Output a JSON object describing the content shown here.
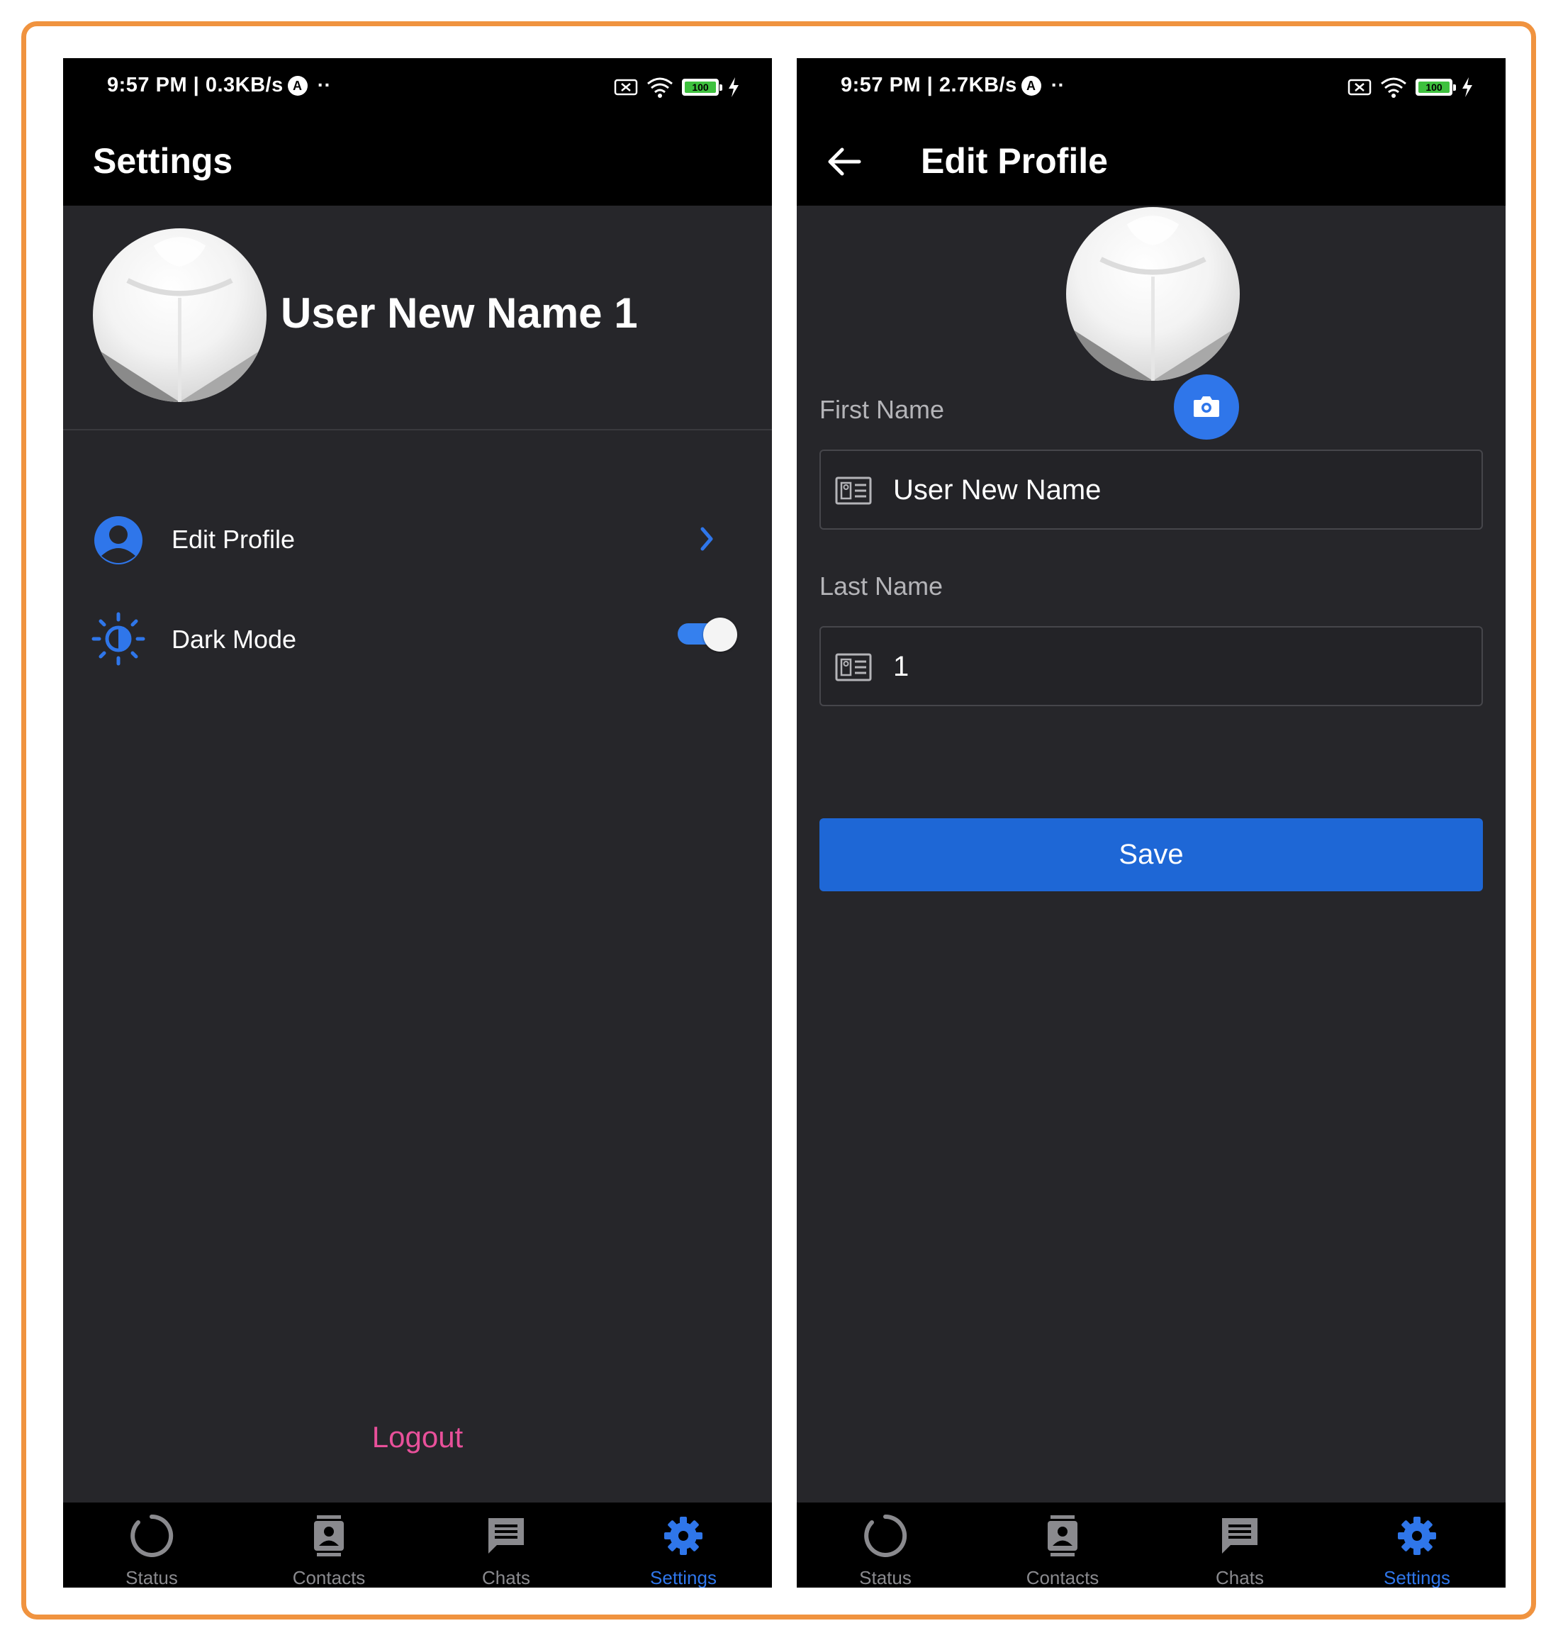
{
  "colors": {
    "frame": "#f0933f",
    "background": "#26262a",
    "bars": "#000000",
    "accent": "#2f76ea",
    "save_button": "#1e67d6",
    "logout": "#e8509a",
    "inactive_tab": "#8a8a8e"
  },
  "settings_screen": {
    "statusbar": {
      "time": "9:57 PM | 0.3KB/s",
      "battery": "100"
    },
    "title": "Settings",
    "user_name": "User New Name 1",
    "menu": [
      {
        "label": "Edit Profile",
        "icon": "user-circle-icon"
      },
      {
        "label": "Dark Mode",
        "icon": "brightness-icon",
        "toggle_on": true
      }
    ],
    "logout_label": "Logout",
    "tabs": [
      {
        "label": "Status",
        "icon": "status-ring-icon"
      },
      {
        "label": "Contacts",
        "icon": "contacts-icon"
      },
      {
        "label": "Chats",
        "icon": "chat-icon"
      },
      {
        "label": "Settings",
        "icon": "gear-icon",
        "active": true
      }
    ]
  },
  "edit_screen": {
    "statusbar": {
      "time": "9:57 PM | 2.7KB/s",
      "battery": "100"
    },
    "title": "Edit Profile",
    "first_name": {
      "label": "First Name",
      "value": "User New Name"
    },
    "last_name": {
      "label": "Last Name",
      "value": "1"
    },
    "save_label": "Save",
    "tabs": [
      {
        "label": "Status",
        "icon": "status-ring-icon"
      },
      {
        "label": "Contacts",
        "icon": "contacts-icon"
      },
      {
        "label": "Chats",
        "icon": "chat-icon"
      },
      {
        "label": "Settings",
        "icon": "gear-icon",
        "active": true
      }
    ]
  }
}
